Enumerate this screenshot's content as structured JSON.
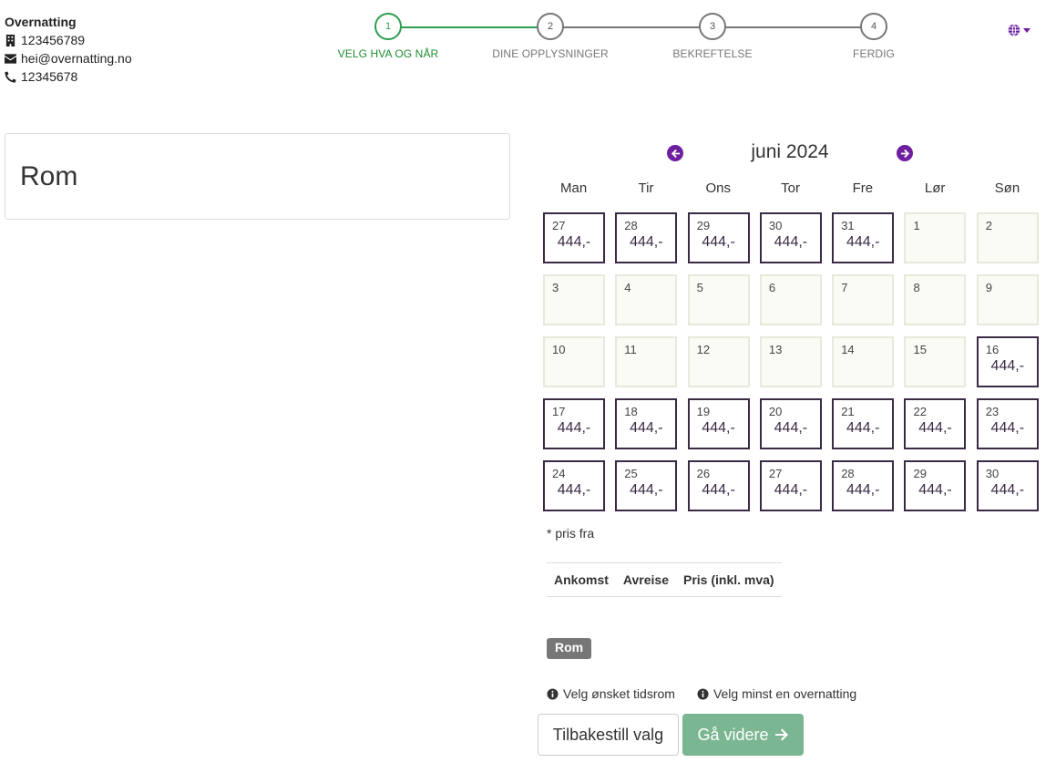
{
  "contact": {
    "name": "Overnatting",
    "org_number": "123456789",
    "email": "hei@overnatting.no",
    "phone": "12345678"
  },
  "steps": [
    {
      "number": "1",
      "label": "VELG HVA OG NÅR"
    },
    {
      "number": "2",
      "label": "DINE OPPLYSNINGER"
    },
    {
      "number": "3",
      "label": "BEKREFTELSE"
    },
    {
      "number": "4",
      "label": "FERDIG"
    }
  ],
  "room_card": {
    "title": "Rom"
  },
  "calendar": {
    "month_label": "juni 2024",
    "weekdays": [
      "Man",
      "Tir",
      "Ons",
      "Tor",
      "Fre",
      "Lør",
      "Søn"
    ],
    "days": [
      {
        "day": "27",
        "price": "444,-"
      },
      {
        "day": "28",
        "price": "444,-"
      },
      {
        "day": "29",
        "price": "444,-"
      },
      {
        "day": "30",
        "price": "444,-"
      },
      {
        "day": "31",
        "price": "444,-"
      },
      {
        "day": "1",
        "price": ""
      },
      {
        "day": "2",
        "price": ""
      },
      {
        "day": "3",
        "price": ""
      },
      {
        "day": "4",
        "price": ""
      },
      {
        "day": "5",
        "price": ""
      },
      {
        "day": "6",
        "price": ""
      },
      {
        "day": "7",
        "price": ""
      },
      {
        "day": "8",
        "price": ""
      },
      {
        "day": "9",
        "price": ""
      },
      {
        "day": "10",
        "price": ""
      },
      {
        "day": "11",
        "price": ""
      },
      {
        "day": "12",
        "price": ""
      },
      {
        "day": "13",
        "price": ""
      },
      {
        "day": "14",
        "price": ""
      },
      {
        "day": "15",
        "price": ""
      },
      {
        "day": "16",
        "price": "444,-"
      },
      {
        "day": "17",
        "price": "444,-"
      },
      {
        "day": "18",
        "price": "444,-"
      },
      {
        "day": "19",
        "price": "444,-"
      },
      {
        "day": "20",
        "price": "444,-"
      },
      {
        "day": "21",
        "price": "444,-"
      },
      {
        "day": "22",
        "price": "444,-"
      },
      {
        "day": "23",
        "price": "444,-"
      },
      {
        "day": "24",
        "price": "444,-"
      },
      {
        "day": "25",
        "price": "444,-"
      },
      {
        "day": "26",
        "price": "444,-"
      },
      {
        "day": "27",
        "price": "444,-"
      },
      {
        "day": "28",
        "price": "444,-"
      },
      {
        "day": "29",
        "price": "444,-"
      },
      {
        "day": "30",
        "price": "444,-"
      }
    ],
    "note": "* pris fra"
  },
  "summary_table": {
    "headers": [
      "Ankomst",
      "Avreise",
      "Pris (inkl. mva)"
    ]
  },
  "room_badge": "Rom",
  "hints": [
    "Velg ønsket tidsrom",
    "Velg minst en overnatting"
  ],
  "buttons": {
    "reset": "Tilbakestill valg",
    "next": "Gå videre"
  },
  "colors": {
    "accent_purple": "#6e1fa0",
    "active_green": "#2e9e4f",
    "next_button": "#7bb692"
  },
  "icons": {
    "org": "building-icon",
    "email": "envelope-icon",
    "phone": "phone-icon",
    "language": "globe-icon",
    "prev": "arrow-left-circle-icon",
    "next": "arrow-right-circle-icon",
    "hint": "info-circle-icon",
    "next_button": "arrow-right-icon"
  }
}
